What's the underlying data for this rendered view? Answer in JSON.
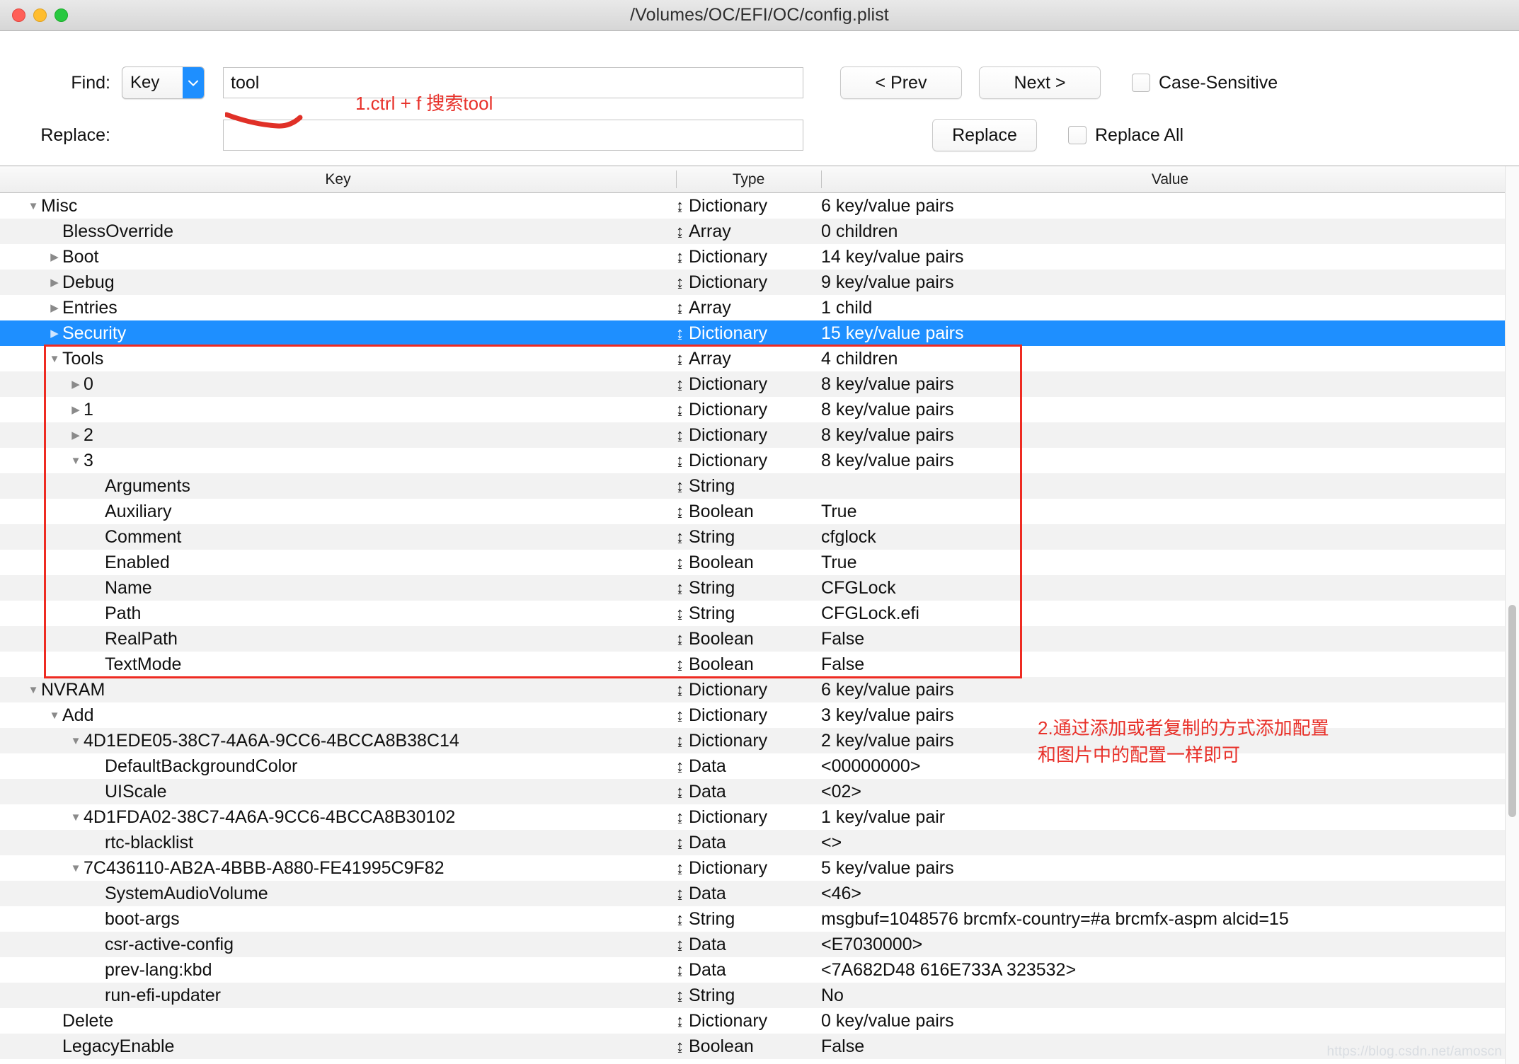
{
  "window": {
    "title": "/Volumes/OC/EFI/OC/config.plist",
    "traffic_lights": [
      "close-button",
      "minimize-button",
      "zoom-button"
    ],
    "accent_color": "#1e8fff",
    "annotation_color": "#e8312a"
  },
  "toolbar": {
    "find_label": "Find:",
    "find_scope_value": "Key",
    "find_value": "tool",
    "find_placeholder": "",
    "replace_label": "Replace:",
    "replace_value": "",
    "replace_placeholder": "",
    "prev_label": "< Prev",
    "next_label": "Next >",
    "case_sensitive_label": "Case-Sensitive",
    "case_sensitive_checked": false,
    "replace_button_label": "Replace",
    "replace_all_label": "Replace All",
    "replace_all_checked": false
  },
  "annotations": {
    "step1": "1.ctrl + f 搜索tool",
    "step2": "2.通过添加或者复制的方式添加配置\n和图片中的配置一样即可"
  },
  "table": {
    "columns": [
      "Key",
      "Type",
      "Value"
    ],
    "rows": [
      {
        "indent": 0,
        "twisty": "down",
        "key": "Misc",
        "type": "Dictionary",
        "value": "6 key/value pairs"
      },
      {
        "indent": 1,
        "twisty": "none",
        "key": "BlessOverride",
        "type": "Array",
        "value": "0 children"
      },
      {
        "indent": 1,
        "twisty": "right",
        "key": "Boot",
        "type": "Dictionary",
        "value": "14 key/value pairs"
      },
      {
        "indent": 1,
        "twisty": "right",
        "key": "Debug",
        "type": "Dictionary",
        "value": "9 key/value pairs"
      },
      {
        "indent": 1,
        "twisty": "right",
        "key": "Entries",
        "type": "Array",
        "value": "1 child"
      },
      {
        "indent": 1,
        "twisty": "right",
        "key": "Security",
        "type": "Dictionary",
        "value": "15 key/value pairs",
        "selected": true
      },
      {
        "indent": 1,
        "twisty": "down",
        "key": "Tools",
        "type": "Array",
        "value": "4 children"
      },
      {
        "indent": 2,
        "twisty": "right",
        "key": "0",
        "type": "Dictionary",
        "value": "8 key/value pairs"
      },
      {
        "indent": 2,
        "twisty": "right",
        "key": "1",
        "type": "Dictionary",
        "value": "8 key/value pairs"
      },
      {
        "indent": 2,
        "twisty": "right",
        "key": "2",
        "type": "Dictionary",
        "value": "8 key/value pairs"
      },
      {
        "indent": 2,
        "twisty": "down",
        "key": "3",
        "type": "Dictionary",
        "value": "8 key/value pairs"
      },
      {
        "indent": 3,
        "twisty": "none",
        "key": "Arguments",
        "type": "String",
        "value": ""
      },
      {
        "indent": 3,
        "twisty": "none",
        "key": "Auxiliary",
        "type": "Boolean",
        "value": "True"
      },
      {
        "indent": 3,
        "twisty": "none",
        "key": "Comment",
        "type": "String",
        "value": "cfglock"
      },
      {
        "indent": 3,
        "twisty": "none",
        "key": "Enabled",
        "type": "Boolean",
        "value": "True"
      },
      {
        "indent": 3,
        "twisty": "none",
        "key": "Name",
        "type": "String",
        "value": "CFGLock"
      },
      {
        "indent": 3,
        "twisty": "none",
        "key": "Path",
        "type": "String",
        "value": "CFGLock.efi"
      },
      {
        "indent": 3,
        "twisty": "none",
        "key": "RealPath",
        "type": "Boolean",
        "value": "False"
      },
      {
        "indent": 3,
        "twisty": "none",
        "key": "TextMode",
        "type": "Boolean",
        "value": "False"
      },
      {
        "indent": 0,
        "twisty": "down",
        "key": "NVRAM",
        "type": "Dictionary",
        "value": "6 key/value pairs"
      },
      {
        "indent": 1,
        "twisty": "down",
        "key": "Add",
        "type": "Dictionary",
        "value": "3 key/value pairs"
      },
      {
        "indent": 2,
        "twisty": "down",
        "key": "4D1EDE05-38C7-4A6A-9CC6-4BCCA8B38C14",
        "type": "Dictionary",
        "value": "2 key/value pairs"
      },
      {
        "indent": 3,
        "twisty": "none",
        "key": "DefaultBackgroundColor",
        "type": "Data",
        "value": "<00000000>"
      },
      {
        "indent": 3,
        "twisty": "none",
        "key": "UIScale",
        "type": "Data",
        "value": "<02>"
      },
      {
        "indent": 2,
        "twisty": "down",
        "key": "4D1FDA02-38C7-4A6A-9CC6-4BCCA8B30102",
        "type": "Dictionary",
        "value": "1 key/value pair"
      },
      {
        "indent": 3,
        "twisty": "none",
        "key": "rtc-blacklist",
        "type": "Data",
        "value": "<>"
      },
      {
        "indent": 2,
        "twisty": "down",
        "key": "7C436110-AB2A-4BBB-A880-FE41995C9F82",
        "type": "Dictionary",
        "value": "5 key/value pairs"
      },
      {
        "indent": 3,
        "twisty": "none",
        "key": "SystemAudioVolume",
        "type": "Data",
        "value": "<46>"
      },
      {
        "indent": 3,
        "twisty": "none",
        "key": "boot-args",
        "type": "String",
        "value": "msgbuf=1048576 brcmfx-country=#a brcmfx-aspm alcid=15"
      },
      {
        "indent": 3,
        "twisty": "none",
        "key": "csr-active-config",
        "type": "Data",
        "value": "<E7030000>"
      },
      {
        "indent": 3,
        "twisty": "none",
        "key": "prev-lang:kbd",
        "type": "Data",
        "value": "<7A682D48 616E733A 323532>"
      },
      {
        "indent": 3,
        "twisty": "none",
        "key": "run-efi-updater",
        "type": "String",
        "value": "No"
      },
      {
        "indent": 1,
        "twisty": "none",
        "key": "Delete",
        "type": "Dictionary",
        "value": "0 key/value pairs"
      },
      {
        "indent": 1,
        "twisty": "none",
        "key": "LegacyEnable",
        "type": "Boolean",
        "value": "False"
      }
    ]
  },
  "watermark": "https://blog.csdn.net/amoscn"
}
